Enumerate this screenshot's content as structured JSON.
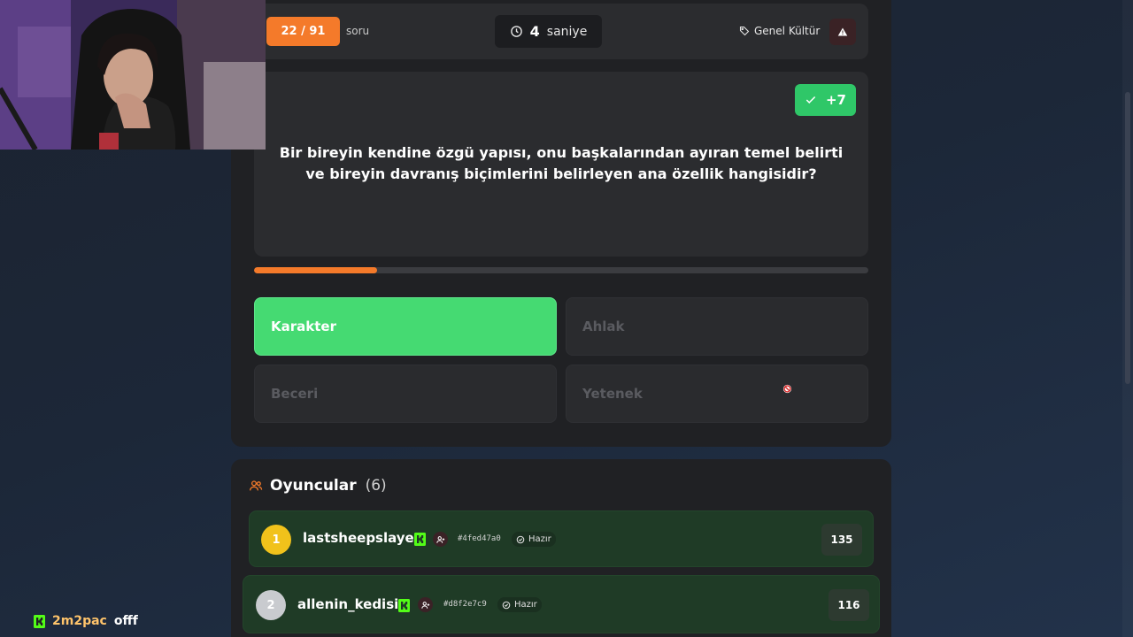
{
  "topbar": {
    "question_counter": "22 / 91",
    "question_label": "soru",
    "timer_value": "4",
    "timer_unit": "saniye",
    "category": "Genel Kültür"
  },
  "question": {
    "points_badge": "+7",
    "text": "Bir bireyin kendine özgü yapısı, onu başkalarından ayıran temel belirti ve bireyin davranış biçimlerini belirleyen ana özellik hangisidir?",
    "progress_fraction": 0.2
  },
  "answers": [
    {
      "label": "Karakter",
      "state": "correct"
    },
    {
      "label": "Ahlak",
      "state": "dimmed"
    },
    {
      "label": "Beceri",
      "state": "dimmed"
    },
    {
      "label": "Yetenek",
      "state": "dimmed"
    }
  ],
  "players": {
    "title": "Oyuncular",
    "count": "(6)",
    "list": [
      {
        "rank": "1",
        "name": "lastsheepslayer",
        "id": "#4fed47a0",
        "status": "Hazır",
        "score": "135"
      },
      {
        "rank": "2",
        "name": "allenin_kedisi",
        "id": "#d8f2e7c9",
        "status": "Hazır",
        "score": "116"
      }
    ]
  },
  "chat": {
    "username": "2m2pac",
    "message": "offf"
  },
  "colors": {
    "accent_orange": "#f47a2a",
    "correct_green": "#45da72",
    "badge_green": "#2fc768",
    "player_row_green": "#1f3b26",
    "kick_green": "#53fc18"
  },
  "icons": {
    "timer": "clock-icon",
    "category": "tag-icon",
    "report": "warning-icon",
    "points": "check-icon",
    "players": "users-icon",
    "platform": "kick-icon",
    "friend": "user-plus-icon",
    "ready": "check-circle-icon",
    "cursor": "not-allowed-icon"
  }
}
